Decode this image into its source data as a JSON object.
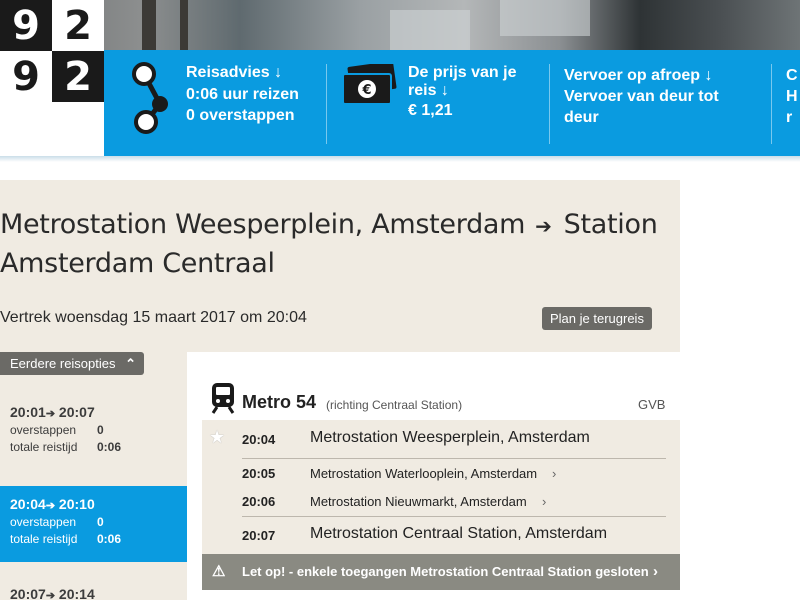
{
  "logo": {
    "digits": [
      "9",
      "2",
      "9",
      "2"
    ]
  },
  "topbar": {
    "items": [
      {
        "title": "Reisadvies",
        "lines": [
          "0:06 uur reizen",
          "0 overstappen"
        ],
        "icon": "route-icon"
      },
      {
        "title_line1": "De prijs van je",
        "title_line2": "reis",
        "lines": [
          "€ 1,21"
        ],
        "icon": "euro-ticket-icon"
      },
      {
        "title": "Vervoer op afroep",
        "lines": [
          "Vervoer van deur tot",
          "deur"
        ],
        "icon": ""
      },
      {
        "title": "C",
        "lines": [
          "H",
          "r"
        ],
        "icon": ""
      }
    ],
    "arrow": "↓"
  },
  "route": {
    "from": "Metrostation Weesperplein, Amsterdam",
    "arrow": "➔",
    "to": "Station Amsterdam Centraal",
    "departure": "Vertrek woensdag 15 maart 2017 om 20:04",
    "return_label": "Plan je terugreis"
  },
  "options": {
    "earlier_label": "Eerdere reisopties",
    "chev": "⌃",
    "labels": {
      "transfers": "overstappen",
      "duration": "totale reistijd"
    },
    "items": [
      {
        "dep": "20:01",
        "arr": "20:07",
        "transfers": "0",
        "duration": "0:06"
      },
      {
        "dep": "20:04",
        "arr": "20:10",
        "transfers": "0",
        "duration": "0:06"
      },
      {
        "dep": "20:07",
        "arr": "20:14"
      }
    ],
    "arrow": "➔"
  },
  "leg": {
    "line": "Metro 54",
    "direction": "(richting Centraal Station)",
    "operator": "GVB",
    "stops": [
      {
        "time": "20:04",
        "name": "Metrostation Weesperplein, Amsterdam"
      },
      {
        "time": "20:05",
        "name": "Metrostation Waterlooplein, Amsterdam"
      },
      {
        "time": "20:06",
        "name": "Metrostation Nieuwmarkt, Amsterdam"
      },
      {
        "time": "20:07",
        "name": "Metrostation Centraal Station, Amsterdam"
      }
    ],
    "go": "›",
    "alert": "Let op! - enkele toegangen Metrostation Centraal Station gesloten",
    "alert_icon": "⚠"
  },
  "colors": {
    "brand_blue": "#0a9be0",
    "panel_beige": "#f0ebe2",
    "button_gray": "#6b6a66"
  }
}
